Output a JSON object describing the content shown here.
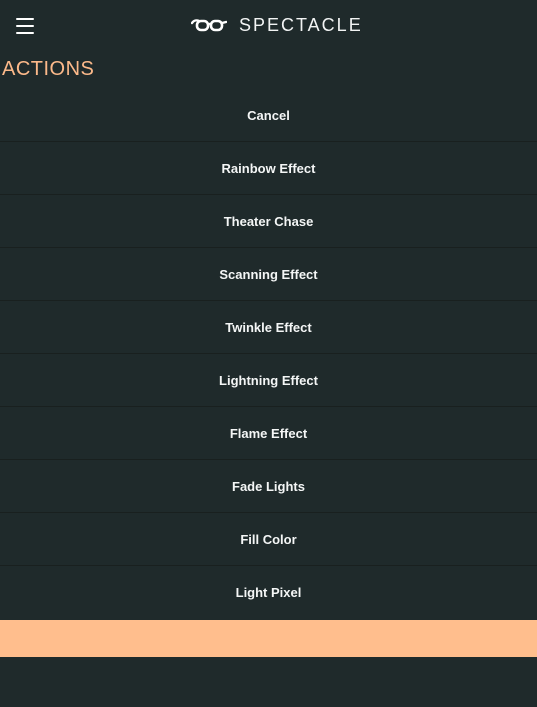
{
  "header": {
    "menu_icon": "hamburger-menu-icon",
    "logo_icon": "spectacle-glasses-logo-icon",
    "brand_name": "SPECTACLE"
  },
  "colors": {
    "background": "#1f2a2b",
    "accent": "#ffbe8d",
    "section_title": "#fcb98a",
    "text": "#ffffff"
  },
  "section": {
    "title": "ACTIONS"
  },
  "actions": [
    {
      "label": "Cancel"
    },
    {
      "label": "Rainbow Effect"
    },
    {
      "label": "Theater Chase"
    },
    {
      "label": "Scanning Effect"
    },
    {
      "label": "Twinkle Effect"
    },
    {
      "label": "Lightning Effect"
    },
    {
      "label": "Flame Effect"
    },
    {
      "label": "Fade Lights"
    },
    {
      "label": "Fill Color"
    },
    {
      "label": "Light Pixel"
    }
  ]
}
